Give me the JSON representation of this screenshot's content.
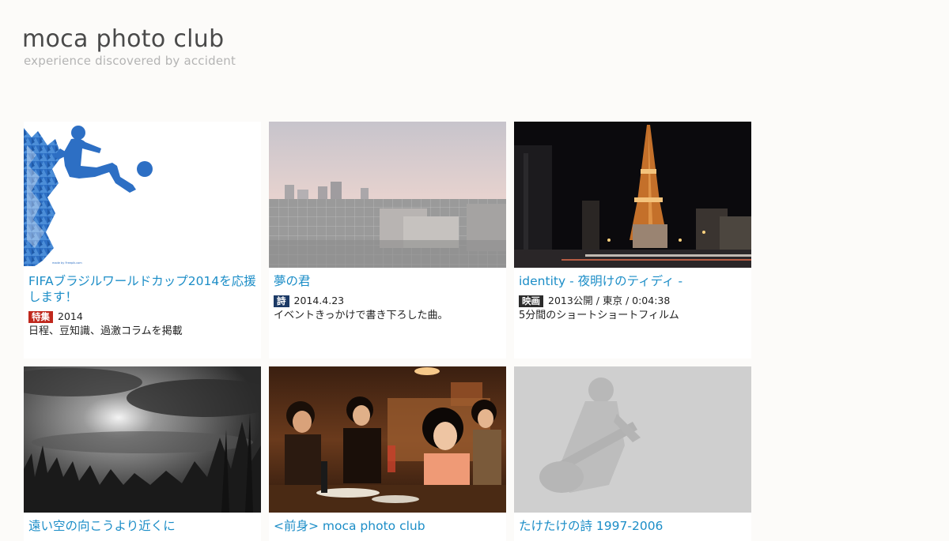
{
  "site": {
    "title": "moca photo club",
    "tagline": "experience discovered by accident"
  },
  "cards": [
    {
      "title": "FIFAブラジルワールドカップ2014を応援します！",
      "badge": "特集",
      "badge_color": "#c0281d",
      "meta": "2014",
      "desc": "日程、豆知識、過激コラムを掲載",
      "thumb": "blue-soccer-player-silhouette",
      "thumb_caption": "made by Freepik.com"
    },
    {
      "title": "夢の君",
      "badge": "詩",
      "badge_color": "#1c3a66",
      "meta": "2014.4.23",
      "desc": "イベントきっかけで書き下ろした曲。",
      "thumb": "city-skyline-at-dusk"
    },
    {
      "title": "identity - 夜明けのティディ -",
      "badge": "映画",
      "badge_color": "#2b2b2b",
      "meta": "2013公開 / 東京 / 0:04:38",
      "desc": "5分間のショートショートフィルム",
      "thumb": "tokyo-tower-at-night"
    },
    {
      "title": "遠い空の向こうより近くに",
      "thumb": "cloudy-sky-over-grass"
    },
    {
      "title": "<前身> moca photo club",
      "thumb": "friends-at-restaurant"
    },
    {
      "title": "たけたけの詩 1997-2006",
      "thumb": "faded-guitar-player"
    }
  ]
}
